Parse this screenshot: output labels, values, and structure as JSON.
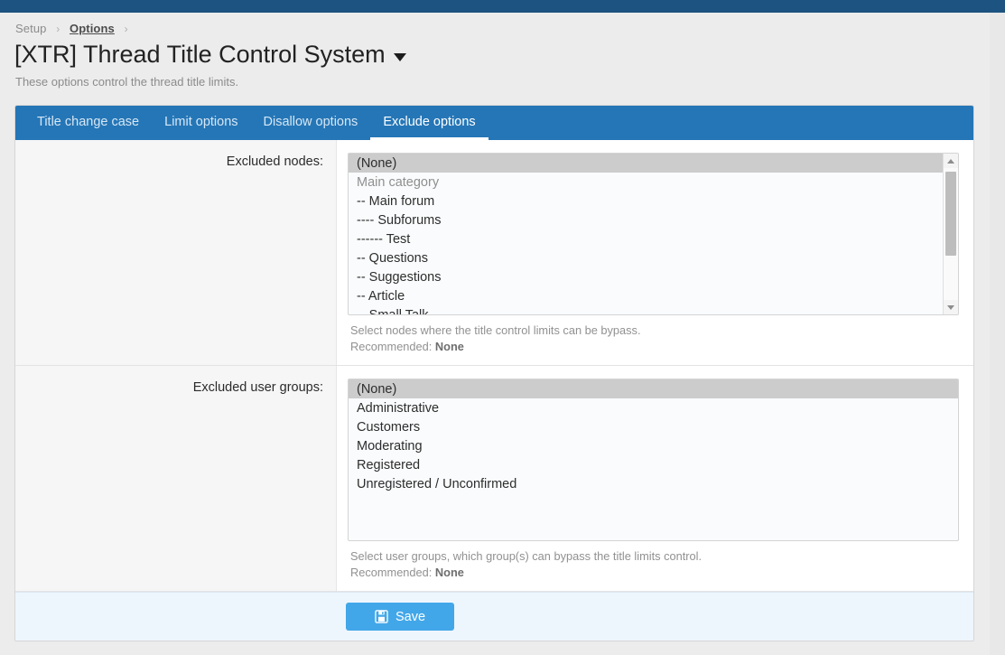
{
  "breadcrumb": {
    "items": [
      {
        "label": "Setup",
        "link": false
      },
      {
        "label": "Options",
        "link": true
      }
    ],
    "separator": "›"
  },
  "header": {
    "title": "[XTR] Thread Title Control System",
    "dropdown_icon": "chevron-down-icon",
    "description": "These options control the thread title limits."
  },
  "tabs": [
    {
      "label": "Title change case",
      "active": false
    },
    {
      "label": "Limit options",
      "active": false
    },
    {
      "label": "Disallow options",
      "active": false
    },
    {
      "label": "Exclude options",
      "active": true
    }
  ],
  "rows": [
    {
      "label": "Excluded nodes:",
      "options": [
        {
          "text": "(None)",
          "selected": true,
          "group": false
        },
        {
          "text": "Main category",
          "selected": false,
          "group": true
        },
        {
          "text": "-- Main forum",
          "selected": false,
          "group": false
        },
        {
          "text": "---- Subforums",
          "selected": false,
          "group": false
        },
        {
          "text": "------ Test",
          "selected": false,
          "group": false
        },
        {
          "text": "-- Questions",
          "selected": false,
          "group": false
        },
        {
          "text": "-- Suggestions",
          "selected": false,
          "group": false
        },
        {
          "text": "-- Article",
          "selected": false,
          "group": false
        },
        {
          "text": "-- Small Talk",
          "selected": false,
          "group": false
        }
      ],
      "hint_line1": "Select nodes where the title control limits can be bypass.",
      "hint_label": "Recommended: ",
      "hint_value": "None",
      "scrollable": true
    },
    {
      "label": "Excluded user groups:",
      "options": [
        {
          "text": "(None)",
          "selected": true,
          "group": false
        },
        {
          "text": "Administrative",
          "selected": false,
          "group": false
        },
        {
          "text": "Customers",
          "selected": false,
          "group": false
        },
        {
          "text": "Moderating",
          "selected": false,
          "group": false
        },
        {
          "text": "Registered",
          "selected": false,
          "group": false
        },
        {
          "text": "Unregistered / Unconfirmed",
          "selected": false,
          "group": false
        }
      ],
      "hint_line1": "Select user groups, which group(s) can bypass the title limits control.",
      "hint_label": "Recommended: ",
      "hint_value": "None",
      "scrollable": false
    }
  ],
  "footer": {
    "save_label": "Save",
    "save_icon": "save-floppy-icon"
  },
  "colors": {
    "topbar": "#1c5380",
    "tabbar": "#2576b6",
    "save_button": "#42a7e8",
    "footer_bg": "#eef6fd",
    "selected_option": "#cccccc"
  }
}
